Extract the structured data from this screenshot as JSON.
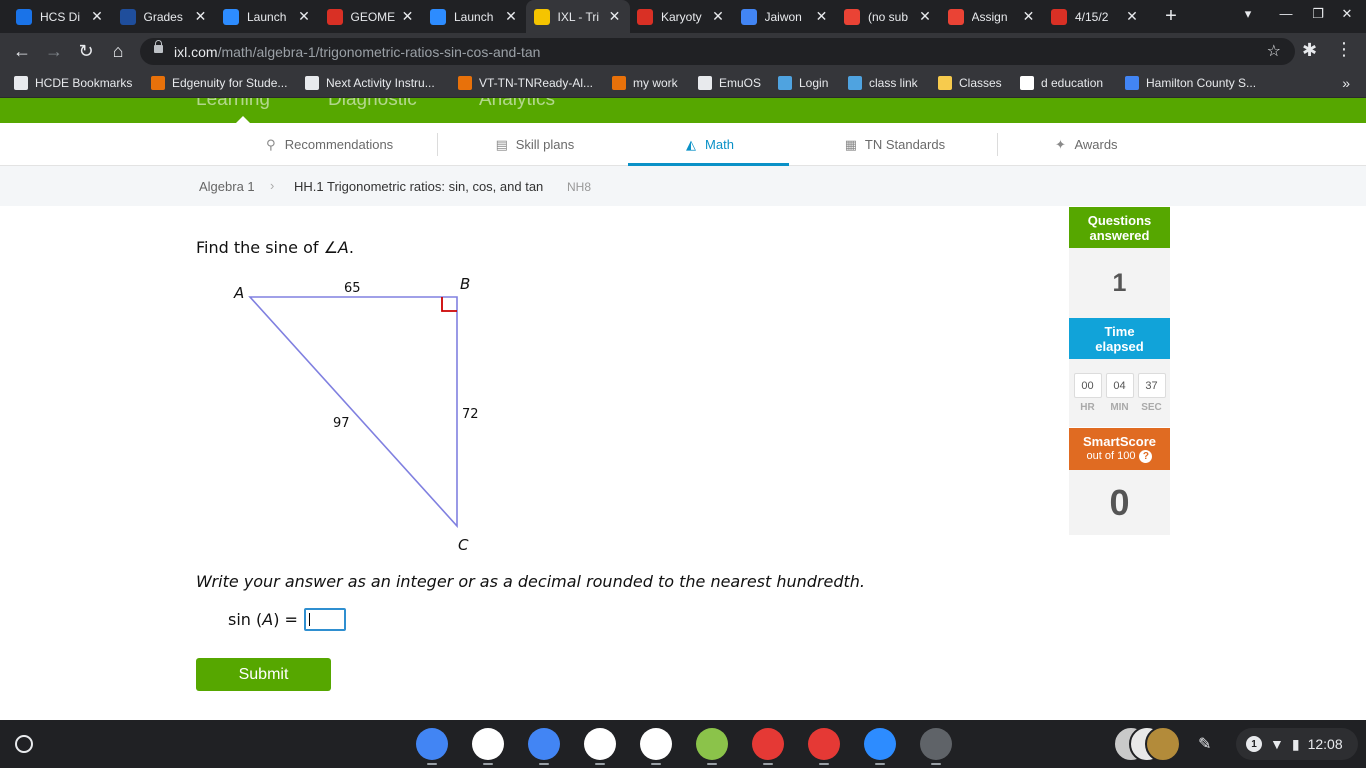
{
  "browser": {
    "tabs": [
      {
        "title": "HCS Di",
        "favicon": "cloud-icon",
        "color": "#1a73e8",
        "active": false
      },
      {
        "title": "Grades",
        "favicon": "sis-icon",
        "color": "#1f4e9c",
        "active": false
      },
      {
        "title": "Launch",
        "favicon": "zoom-icon",
        "color": "#2d8cff",
        "active": false
      },
      {
        "title": "GEOME",
        "favicon": "spinner-icon",
        "color": "#d93025",
        "active": false
      },
      {
        "title": "Launch",
        "favicon": "zoom-icon",
        "color": "#2d8cff",
        "active": false
      },
      {
        "title": "IXL - Tri",
        "favicon": "ixl-icon",
        "color": "#f5c400",
        "active": true
      },
      {
        "title": "Karyoty",
        "favicon": "spinner-icon",
        "color": "#d93025",
        "active": false
      },
      {
        "title": "Jaiwon",
        "favicon": "docs-icon",
        "color": "#4285f4",
        "active": false
      },
      {
        "title": "(no sub",
        "favicon": "gmail-icon",
        "color": "#ea4335",
        "active": false
      },
      {
        "title": "Assign",
        "favicon": "gmail-icon",
        "color": "#ea4335",
        "active": false
      },
      {
        "title": "4/15/2",
        "favicon": "spinner-icon",
        "color": "#d93025",
        "active": false
      }
    ],
    "url_host": "ixl.com",
    "url_path": "/math/algebra-1/trigonometric-ratios-sin-cos-and-tan",
    "bookmarks": [
      {
        "label": "HCDE Bookmarks",
        "icon": "folder-icon",
        "color": "#e8eaed"
      },
      {
        "label": "Edgenuity for Stude...",
        "icon": "edgenuity-icon",
        "color": "#e8710a"
      },
      {
        "label": "Next Activity Instru...",
        "icon": "globe-icon",
        "color": "#e8eaed"
      },
      {
        "label": "VT-TN-TNReady-Al...",
        "icon": "edgenuity-icon",
        "color": "#e8710a"
      },
      {
        "label": "my work",
        "icon": "edgenuity-icon",
        "color": "#e8710a"
      },
      {
        "label": "EmuOS",
        "icon": "globe-icon",
        "color": "#e8eaed"
      },
      {
        "label": "Login",
        "icon": "login-icon",
        "color": "#4fa3e0"
      },
      {
        "label": "class link",
        "icon": "classlink-icon",
        "color": "#4fa3e0"
      },
      {
        "label": "Classes",
        "icon": "classes-icon",
        "color": "#f7cb4d"
      },
      {
        "label": "d education",
        "icon": "google-icon",
        "color": "#ffffff"
      },
      {
        "label": "Hamilton County S...",
        "icon": "calendar-icon",
        "color": "#4285f4"
      }
    ]
  },
  "ixl": {
    "top_nav": [
      "Learning",
      "Diagnostic",
      "Analytics"
    ],
    "subnav": [
      {
        "label": "Recommendations",
        "icon": "recommendations-icon",
        "active": false
      },
      {
        "label": "Skill plans",
        "icon": "skill-plans-icon",
        "active": false
      },
      {
        "label": "Math",
        "icon": "math-icon",
        "active": true
      },
      {
        "label": "TN Standards",
        "icon": "standards-icon",
        "active": false
      },
      {
        "label": "Awards",
        "icon": "awards-icon",
        "active": false
      }
    ],
    "breadcrumb": {
      "course": "Algebra 1",
      "skill": "HH.1 Trigonometric ratios: sin, cos, and tan",
      "code": "NH8"
    },
    "question": {
      "prompt_prefix": "Find the sine of ∠",
      "prompt_var": "A",
      "prompt_suffix": ".",
      "triangle": {
        "vertex_a": "A",
        "vertex_b": "B",
        "vertex_c": "C",
        "side_ab": "65",
        "side_bc": "72",
        "side_ac": "97"
      },
      "instruction": "Write your answer as an integer or as a decimal rounded to the nearest hundredth.",
      "answer_label_prefix": "sin (",
      "answer_label_var": "A",
      "answer_label_suffix": ") =",
      "answer_value": "",
      "submit_label": "Submit"
    },
    "stats": {
      "questions_label_1": "Questions",
      "questions_label_2": "answered",
      "questions_answered": "1",
      "time_label_1": "Time",
      "time_label_2": "elapsed",
      "hr": "00",
      "min": "04",
      "sec": "37",
      "hr_label": "HR",
      "min_label": "MIN",
      "sec_label": "SEC",
      "smartscore_label": "SmartScore",
      "smartscore_sub": "out of 100",
      "smartscore": "0"
    },
    "colors": {
      "green": "#56a700",
      "blue": "#11a3d9",
      "orange": "#e06b22",
      "triangle_stroke": "#8080e0",
      "right_angle": "#cc0000"
    }
  },
  "shelf": {
    "apps": [
      {
        "name": "chrome-icon",
        "color": "#4285f4"
      },
      {
        "name": "gmail-icon",
        "color": "#ffffff"
      },
      {
        "name": "docs-icon",
        "color": "#4285f4"
      },
      {
        "name": "play-store-icon",
        "color": "#ffffff"
      },
      {
        "name": "calculator-icon",
        "color": "#ffffff"
      },
      {
        "name": "timer-icon",
        "color": "#8bc34a"
      },
      {
        "name": "gallery-icon",
        "color": "#e53935"
      },
      {
        "name": "headphones-icon",
        "color": "#e53935"
      },
      {
        "name": "zoom-icon",
        "color": "#2d8cff"
      },
      {
        "name": "settings-icon",
        "color": "#5f6368"
      }
    ],
    "notification_count": "1",
    "time": "12:08"
  }
}
